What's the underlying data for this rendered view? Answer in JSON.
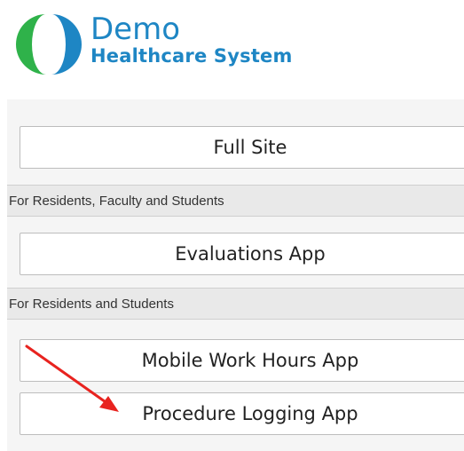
{
  "logo": {
    "title": "Demo",
    "subtitle": "Healthcare System",
    "icon": "split-circle-logo-icon",
    "colors": {
      "green": "#2fb24a",
      "blue": "#1e86c4"
    }
  },
  "buttons": {
    "full_site": "Full Site",
    "evaluations": "Evaluations App",
    "work_hours": "Mobile Work Hours App",
    "procedure_logging": "Procedure Logging App"
  },
  "sections": {
    "residents_faculty_students": "For Residents, Faculty and Students",
    "residents_students": "For Residents and Students"
  },
  "annotation": {
    "icon": "red-arrow-icon",
    "color": "#e8231f"
  }
}
